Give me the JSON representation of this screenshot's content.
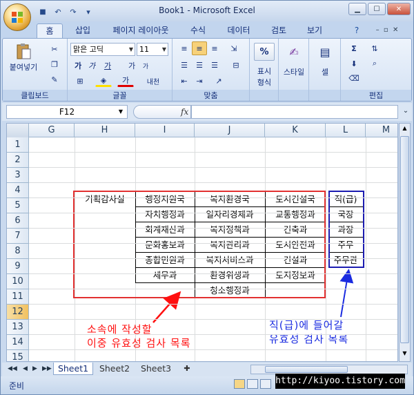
{
  "window": {
    "title": "Book1 - Microsoft Excel",
    "controls": {
      "minimize": "▁",
      "maximize": "☐",
      "close": "✕"
    }
  },
  "qat": {
    "save_icon": "💾",
    "undo_icon": "↶",
    "redo_icon": "↷",
    "customize_icon": "▾"
  },
  "ribbon_tabs": [
    "홈",
    "삽입",
    "페이지 레이아웃",
    "수식",
    "데이터",
    "검토",
    "보기"
  ],
  "ribbon": {
    "clipboard": {
      "paste_label": "붙여넣기",
      "group_label": "클립보드"
    },
    "font": {
      "font_name": "맑은 고딕",
      "font_size": "11",
      "bold": "가",
      "italic": "가",
      "underline": "가",
      "grow": "가",
      "shrink": "가",
      "strike": "내천",
      "group_label": "글꼴"
    },
    "alignment": {
      "group_label": "맞춤"
    },
    "number": {
      "label": "표시\n형식",
      "percent": "%",
      "group_label": ""
    },
    "styles": {
      "label": "스타일"
    },
    "cells": {
      "label": "셀"
    },
    "editing": {
      "group_label": "편집",
      "sum": "Σ"
    }
  },
  "formula_bar": {
    "name_box": "F12",
    "fx": "fx",
    "value": ""
  },
  "columns": [
    "G",
    "H",
    "I",
    "J",
    "K",
    "L",
    "M"
  ],
  "selected_column": "",
  "rows": [
    "1",
    "2",
    "3",
    "4",
    "5",
    "6",
    "7",
    "8",
    "9",
    "10",
    "11",
    "12",
    "13",
    "14",
    "15"
  ],
  "selected_row": "12",
  "cells": {
    "row4": [
      "기획감사실",
      "행정지원국",
      "복지환경국",
      "도시건설국",
      "직(급)"
    ],
    "row5": [
      "",
      "자치행정과",
      "일자리경제과",
      "교통행정과",
      "국장"
    ],
    "row6": [
      "",
      "회계재산과",
      "복지정책과",
      "건축과",
      "과장"
    ],
    "row7": [
      "",
      "문화홍보과",
      "복지관리과",
      "도시안전과",
      "주무"
    ],
    "row8": [
      "",
      "종합민원과",
      "복지서비스과",
      "건설과",
      "주무관"
    ],
    "row9": [
      "",
      "세무과",
      "환경위생과",
      "토지정보과",
      ""
    ],
    "row10": [
      "",
      "",
      "청소행정과",
      "",
      ""
    ]
  },
  "annotations": {
    "red_line1": "소속에 작성할",
    "red_line2": "이중 유효성 검사 목록",
    "blue_line1": "직(급)에 들어갈",
    "blue_line2": "유효성 검사 목록"
  },
  "sheets": [
    "Sheet1",
    "Sheet2",
    "Sheet3"
  ],
  "active_sheet": "Sheet1",
  "status": {
    "ready": "준비"
  },
  "watermark": "http://kiyoo.tistory.com",
  "colors": {
    "red": "#e23030",
    "blue": "#1b1bb0"
  }
}
